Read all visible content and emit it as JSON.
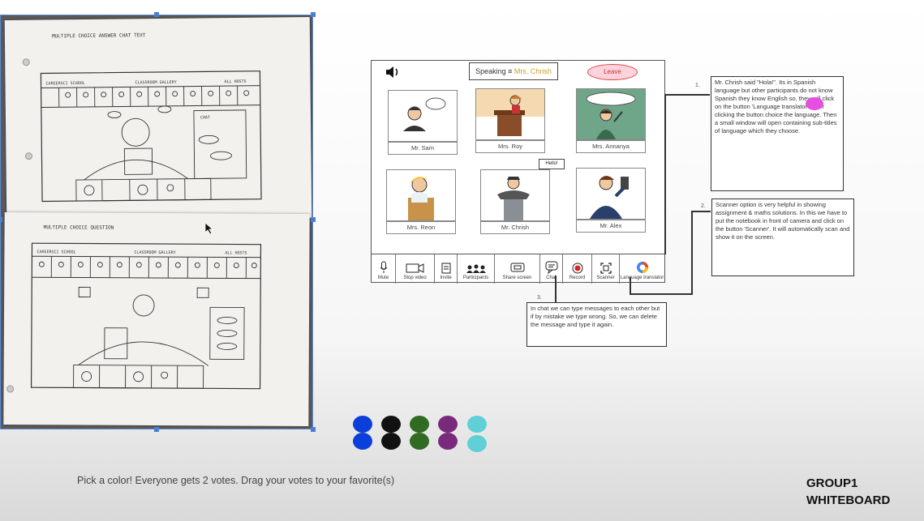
{
  "sketch": {
    "sheet1_title": "MULTIPLE CHOICE ANSWER CHAT TEXT",
    "sheet1_tabs": [
      "CAREERSCI SCHOOL",
      "CLASSROOM GALLERY",
      "ALL HOSTS"
    ],
    "sheet1_chat": "CHAT",
    "sheet2_title": "MULTIPLE CHOICE QUESTION",
    "sheet2_tabs": [
      "CAREERSCI SCHOOL",
      "CLASSROOM GALLERY",
      "ALL HOSTS"
    ]
  },
  "mockup": {
    "speaking_prefix": "Speaking ≡",
    "speaking_name": "Mrs. Chrish",
    "leave_label": "Leave",
    "hello_bubble": "Hello!",
    "participants": [
      {
        "name": "Mr. Sam"
      },
      {
        "name": "Mrs. Roy"
      },
      {
        "name": "Mrs. Annanya"
      },
      {
        "name": "Mrs. Reon"
      },
      {
        "name": "Mr. Chrish"
      },
      {
        "name": "Mr. Alex"
      }
    ],
    "toolbar": [
      "Mute",
      "Stop video",
      "Invite",
      "Participants",
      "Share screen",
      "Chat",
      "Record",
      "Scanner",
      "Language translator"
    ]
  },
  "notes": {
    "n1_number": "1.",
    "n1_text": "Mr. Chrish said \"Hola!\". Its in Spanish language but other participants do not know Spanish they know English so, they will click on the button 'Language translator'. After clicking the button choice the language. Then a small window will open containing sub-titles of language which they choose.",
    "n2_number": "2.",
    "n2_text": "Scanner option is very helpful in showing assignment & maths solutions. In this we have to put the notebook in front of camera and click on the button 'Scanner'. It will automatically scan and show it on the screen.",
    "n3_number": "3.",
    "n3_text": "In chat we can type messages to each other but if by mistake we type wrong. So, we can delete the message and type it again."
  },
  "votes": {
    "colors": [
      "#0b3fd9",
      "#111111",
      "#2f6b22",
      "#7a2a7a",
      "#5fd0d6"
    ],
    "prompt": "Pick a color! Everyone gets 2 votes. Drag your votes to your favorite(s)"
  },
  "board": {
    "line1": "GROUP1",
    "line2": "WHITEBOARD"
  },
  "icons": {
    "speaker": "speaker-icon",
    "mic": "microphone-icon",
    "video": "video-icon",
    "invite": "invite-icon",
    "participants": "participants-icon",
    "share": "share-screen-icon",
    "chat": "chat-icon",
    "record": "record-icon",
    "scanner": "scanner-icon",
    "translate": "translate-icon"
  }
}
